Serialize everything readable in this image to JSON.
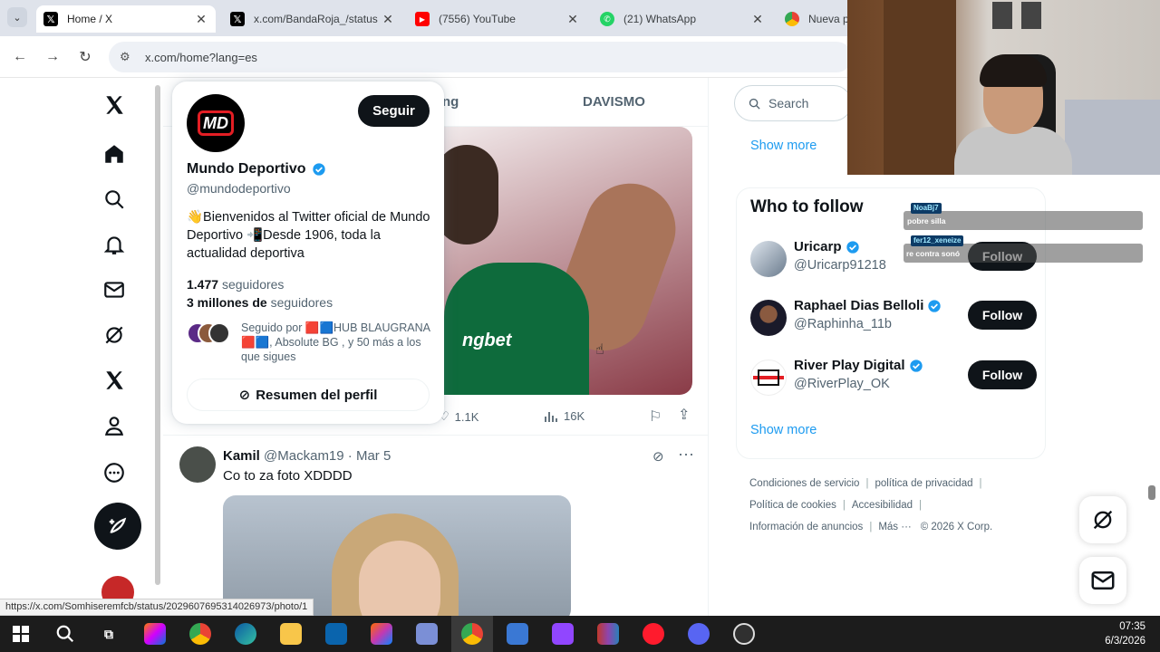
{
  "browser": {
    "tabs": [
      {
        "title": "Home / X",
        "favicon": "x-logo-icon",
        "active": true
      },
      {
        "title": "x.com/BandaRoja_/status",
        "favicon": "x-logo-icon",
        "active": false
      },
      {
        "title": "(7556) YouTube",
        "favicon": "youtube-icon",
        "active": false
      },
      {
        "title": "(21) WhatsApp",
        "favicon": "whatsapp-icon",
        "active": false
      },
      {
        "title": "Nueva pe",
        "favicon": "chrome-icon",
        "active": false
      }
    ],
    "url": "x.com/home?lang=es",
    "status_url": "https://x.com/Somhiseremfcb/status/2029607695314026973/photo/1"
  },
  "feed": {
    "tabs": [
      "ng",
      "DAVISMO"
    ],
    "post1": {
      "image_logo": "ngbet",
      "likes": "1.1K",
      "views": "16K"
    },
    "post2": {
      "name": "Kamil",
      "handle": "@Mackam19",
      "separator": "·",
      "date": "Mar 5",
      "text": "Co to za foto XDDDD"
    }
  },
  "hovercard": {
    "avatar_text": "MD",
    "follow_label": "Seguir",
    "name": "Mundo Deportivo",
    "handle": "@mundodeportivo",
    "bio": "👋Bienvenidos al Twitter oficial de Mundo Deportivo 📲Desde 1906, toda la actualidad deportiva",
    "following_count": "1.477",
    "following_label": "seguidores",
    "followers_count": "3 millones de",
    "followers_label": "seguidores",
    "followed_by": "Seguido por 🟥🟦HUB BLAUGRANA🟥🟦, Absolute BG , y 50 más a los que sigues",
    "summary_label": "Resumen del perfil"
  },
  "sidebar_right": {
    "search_placeholder": "Search",
    "show_more": "Show more",
    "who_to_follow_title": "Who to follow",
    "suggestions": [
      {
        "name": "Uricarp",
        "handle": "@Uricarp91218",
        "follow_label": "Follow"
      },
      {
        "name": "Raphael Dias Belloli",
        "handle": "@Raphinha_11b",
        "follow_label": "Follow"
      },
      {
        "name": "River Play Digital",
        "handle": "@RiverPlay_OK",
        "follow_label": "Follow"
      }
    ],
    "show_more_2": "Show more",
    "footer": {
      "terms": "Condiciones de servicio",
      "privacy": "política de privacidad",
      "cookies": "Política de cookies",
      "accessibility": "Accesibilidad",
      "ads": "Información de anuncios",
      "more": "Más ···",
      "copyright": "© 2026 X Corp."
    }
  },
  "overlay": {
    "chat": [
      {
        "user": "NoaBj7",
        "message": "pobre silla"
      },
      {
        "user": "fer12_xeneize",
        "message": "re contra sonó"
      }
    ]
  },
  "taskbar": {
    "time": "07:35",
    "date": "6/3/2026",
    "apps": [
      "windows-start-icon",
      "search-icon",
      "task-view-icon",
      "copilot-icon",
      "chrome-icon",
      "edge-icon",
      "file-explorer-icon",
      "outlook-icon",
      "copilot-365-icon",
      "app-icon",
      "chrome-active-icon",
      "store-icon",
      "twitch-icon",
      "winrar-icon",
      "opera-icon",
      "discord-icon",
      "obs-icon"
    ]
  },
  "colors": {
    "accent": "#1d9bf0",
    "text": "#0f1419",
    "muted": "#536471",
    "button": "#0f1419"
  }
}
